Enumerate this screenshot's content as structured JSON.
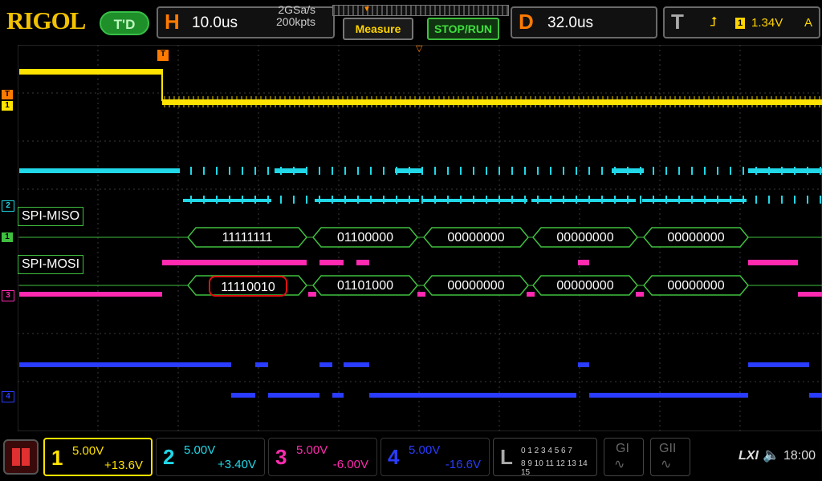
{
  "brand": "RIGOL",
  "td_button": "T'D",
  "horizontal": {
    "icon": "H",
    "timebase": "10.0us",
    "sample_rate": "2GSa/s",
    "memory": "200kpts"
  },
  "measure_button": "Measure",
  "stop_button": "STOP/RUN",
  "delay": {
    "icon": "D",
    "value": "32.0us"
  },
  "trigger": {
    "icon": "T",
    "channel": "1",
    "level": "1.34V",
    "mode": "A"
  },
  "decode_labels": {
    "miso": "SPI-MISO",
    "mosi": "SPI-MOSI"
  },
  "miso_bytes": [
    "11111111",
    "01100000",
    "00000000",
    "00000000",
    "00000000"
  ],
  "mosi_bytes": [
    "11110010",
    "01101000",
    "00000000",
    "00000000",
    "00000000"
  ],
  "markers": {
    "trig": "T",
    "ch1": "1",
    "ch2": "2",
    "digital": "1",
    "ch3": "3",
    "ch4": "4"
  },
  "channels": [
    {
      "n": "1",
      "scale": "5.00V",
      "offset": "+13.6V",
      "color": "#ffe300"
    },
    {
      "n": "2",
      "scale": "5.00V",
      "offset": "+3.40V",
      "color": "#20d8e8"
    },
    {
      "n": "3",
      "scale": "5.00V",
      "offset": "-6.00V",
      "color": "#ff2ab0"
    },
    {
      "n": "4",
      "scale": "5.00V",
      "offset": "-16.6V",
      "color": "#2a3cff"
    }
  ],
  "logic": {
    "icon": "L",
    "row1": "0 1 2 3  4 5 6 7",
    "row2": "8 9 10 11 12 13 14 15"
  },
  "gen1": "GI",
  "gen2": "GII",
  "lxi": "LXI",
  "time": "18:00"
}
